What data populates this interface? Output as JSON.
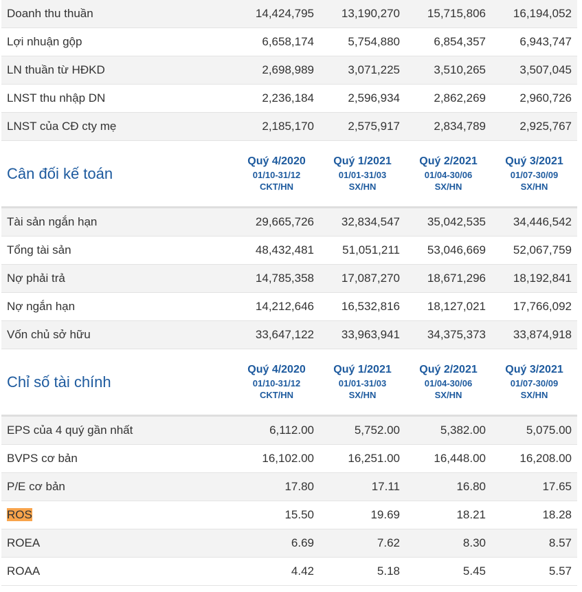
{
  "quarter_headers": [
    {
      "name": "Quý 4/2020",
      "range": "01/10-31/12",
      "type": "CKT/HN"
    },
    {
      "name": "Quý 1/2021",
      "range": "01/01-31/03",
      "type": "SX/HN"
    },
    {
      "name": "Quý 2/2021",
      "range": "01/04-30/06",
      "type": "SX/HN"
    },
    {
      "name": "Quý 3/2021",
      "range": "01/07-30/09",
      "type": "SX/HN"
    }
  ],
  "income_rows": [
    {
      "label": "Doanh thu thuần",
      "values": [
        "14,424,795",
        "13,190,270",
        "15,715,806",
        "16,194,052"
      ]
    },
    {
      "label": "Lợi nhuận gộp",
      "values": [
        "6,658,174",
        "5,754,880",
        "6,854,357",
        "6,943,747"
      ]
    },
    {
      "label": "LN thuần từ HĐKD",
      "values": [
        "2,698,989",
        "3,071,225",
        "3,510,265",
        "3,507,045"
      ]
    },
    {
      "label": "LNST thu nhập DN",
      "values": [
        "2,236,184",
        "2,596,934",
        "2,862,269",
        "2,960,726"
      ]
    },
    {
      "label": "LNST của CĐ cty mẹ",
      "values": [
        "2,185,170",
        "2,575,917",
        "2,834,789",
        "2,925,767"
      ]
    }
  ],
  "balance": {
    "title": "Cân đối kế toán",
    "rows": [
      {
        "label": "Tài sản ngắn hạn",
        "values": [
          "29,665,726",
          "32,834,547",
          "35,042,535",
          "34,446,542"
        ]
      },
      {
        "label": "Tổng tài sản",
        "values": [
          "48,432,481",
          "51,051,211",
          "53,046,669",
          "52,067,759"
        ]
      },
      {
        "label": "Nợ phải trả",
        "values": [
          "14,785,358",
          "17,087,270",
          "18,671,296",
          "18,192,841"
        ]
      },
      {
        "label": "Nợ ngắn hạn",
        "values": [
          "14,212,646",
          "16,532,816",
          "18,127,021",
          "17,766,092"
        ]
      },
      {
        "label": "Vốn chủ sở hữu",
        "values": [
          "33,647,122",
          "33,963,941",
          "34,375,373",
          "33,874,918"
        ]
      }
    ]
  },
  "ratios": {
    "title": "Chỉ số tài chính",
    "rows": [
      {
        "label": "EPS của 4 quý gần nhất",
        "values": [
          "6,112.00",
          "5,752.00",
          "5,382.00",
          "5,075.00"
        ]
      },
      {
        "label": "BVPS cơ bản",
        "values": [
          "16,102.00",
          "16,251.00",
          "16,448.00",
          "16,208.00"
        ]
      },
      {
        "label": "P/E cơ bản",
        "values": [
          "17.80",
          "17.11",
          "16.80",
          "17.65"
        ]
      },
      {
        "label": "ROS",
        "values": [
          "15.50",
          "19.69",
          "18.21",
          "18.28"
        ],
        "highlight": true
      },
      {
        "label": "ROEA",
        "values": [
          "6.69",
          "7.62",
          "8.30",
          "8.57"
        ]
      },
      {
        "label": "ROAA",
        "values": [
          "4.42",
          "5.18",
          "5.45",
          "5.57"
        ]
      }
    ]
  },
  "colors": {
    "accent": "#1d5a9e",
    "highlight": "#f8a44b",
    "row_alt": "#f3f3f3"
  }
}
